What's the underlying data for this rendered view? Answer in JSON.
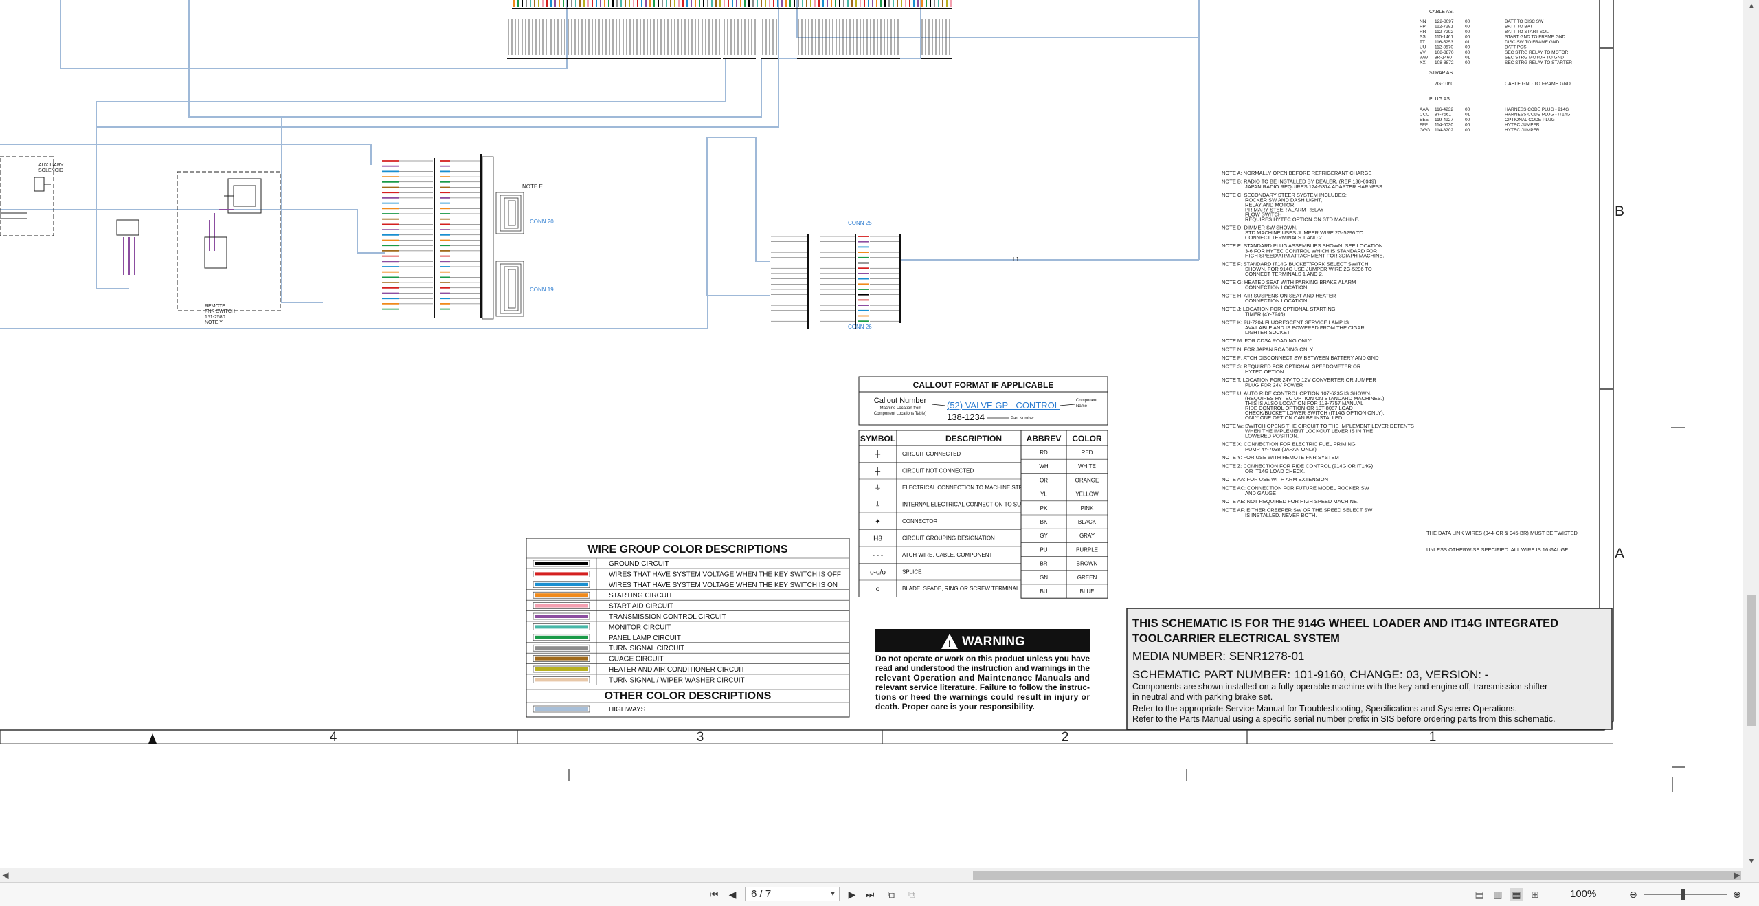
{
  "wire_colors": [
    {
      "label": "GROUND CIRCUIT",
      "color": "#000000"
    },
    {
      "label": "WIRES THAT HAVE SYSTEM VOLTAGE WHEN THE KEY SWITCH IS OFF",
      "color": "#d42020"
    },
    {
      "label": "WIRES THAT HAVE SYSTEM VOLTAGE WHEN THE KEY SWITCH IS ON",
      "color": "#1a8fd0"
    },
    {
      "label": "STARTING CIRCUIT",
      "color": "#f08a1c"
    },
    {
      "label": "START AID CIRCUIT",
      "color": "#f4a0b0"
    },
    {
      "label": "TRANSMISSION CONTROL CIRCUIT",
      "color": "#8c4ea0"
    },
    {
      "label": "MONITOR CIRCUIT",
      "color": "#48b8a8"
    },
    {
      "label": "PANEL LAMP CIRCUIT",
      "color": "#1a9a48"
    },
    {
      "label": "TURN SIGNAL CIRCUIT",
      "color": "#8c8c8c"
    },
    {
      "label": "GUAGE CIRCUIT",
      "color": "#a06a1c"
    },
    {
      "label": "HEATER AND AIR CONDITIONER CIRCUIT",
      "color": "#b8b020"
    },
    {
      "label": "TURN SIGNAL / WIPER WASHER CIRCUIT",
      "color": "#e8c8a8"
    }
  ],
  "wire_group_title": "WIRE GROUP COLOR DESCRIPTIONS",
  "other_color_title": "OTHER COLOR DESCRIPTIONS",
  "other_colors": [
    {
      "label": "HIGHWAYS",
      "color": "#a8bfd8"
    }
  ],
  "callout": {
    "title": "CALLOUT FORMAT IF APPLICABLE",
    "number_label": "Callout Number",
    "number_sub1": "(Machine Location from",
    "number_sub2": "Component Locations Table)",
    "example": "(52) VALVE GP - CONTROL",
    "part": "138-1234",
    "component_label1": "Component",
    "component_label2": "Name",
    "part_label": "Part Number"
  },
  "symbol_table": {
    "headers": [
      "SYMBOL",
      "DESCRIPTION"
    ],
    "rows": [
      {
        "sym": "┼",
        "desc": "CIRCUIT CONNECTED"
      },
      {
        "sym": "┼",
        "desc": "CIRCUIT NOT CONNECTED"
      },
      {
        "sym": "⏚",
        "desc": "ELECTRICAL CONNECTION TO MACHINE STRUCTURE"
      },
      {
        "sym": "⏚",
        "desc": "INTERNAL ELECTRICAL CONNECTION TO SURFACE OF COMPONENT"
      },
      {
        "sym": "✦",
        "desc": "CONNECTOR"
      },
      {
        "sym": "H8",
        "desc": "CIRCUIT GROUPING DESIGNATION"
      },
      {
        "sym": "- - -",
        "desc": "ATCH WIRE, CABLE, COMPONENT"
      },
      {
        "sym": "o-o/o",
        "desc": "SPLICE"
      },
      {
        "sym": "o",
        "desc": "BLADE, SPADE, RING OR SCREW TERMINAL"
      }
    ]
  },
  "abbrev_table": {
    "headers": [
      "ABBREV",
      "COLOR"
    ],
    "rows": [
      [
        "RD",
        "RED"
      ],
      [
        "WH",
        "WHITE"
      ],
      [
        "OR",
        "ORANGE"
      ],
      [
        "YL",
        "YELLOW"
      ],
      [
        "PK",
        "PINK"
      ],
      [
        "BK",
        "BLACK"
      ],
      [
        "GY",
        "GRAY"
      ],
      [
        "PU",
        "PURPLE"
      ],
      [
        "BR",
        "BROWN"
      ],
      [
        "GN",
        "GREEN"
      ],
      [
        "BU",
        "BLUE"
      ]
    ]
  },
  "warning": {
    "title": "WARNING",
    "text": [
      "Do not operate or work on this product unless you have",
      "read and understood the instruction and warnings in the",
      "relevant Operation and Maintenance Manuals and",
      "relevant service literature. Failure to follow the instruc-",
      "tions or heed the warnings could result in injury or",
      "death. Proper care is your responsibility."
    ]
  },
  "title_block": {
    "line1": "THIS SCHEMATIC IS FOR THE 914G WHEEL LOADER AND IT14G INTEGRATED",
    "line2": "TOOLCARRIER ELECTRICAL SYSTEM",
    "media": "MEDIA NUMBER: SENR1278-01",
    "part": "SCHEMATIC PART NUMBER: 101-9160, CHANGE: 03, VERSION: -",
    "notes": [
      "Components are shown installed on a fully operable machine with the key and engine off, transmission shifter",
      "in neutral and with parking brake set.",
      "Refer to the appropriate Service Manual for Troubleshooting, Specifications and Systems Operations.",
      "Refer to the Parts Manual using a specific serial number prefix in SIS before ordering parts from this schematic."
    ]
  },
  "zone_columns": [
    "4",
    "3",
    "2",
    "1"
  ],
  "zone_rows": [
    "B",
    "A"
  ],
  "connectors": {
    "conn_a": "CONN 20",
    "conn_b": "CONN 19",
    "conn_c": "CONN 25",
    "conn_d": "CONN 26",
    "note_e": "NOTE E",
    "remote": "REMOTE",
    "remote2": "FNR SWITCH",
    "remote3": "151-2580",
    "remote4": "NOTE Y",
    "aux": "AUXILIARY",
    "solenoid": "SOLENOID",
    "l1": "L1"
  },
  "notes": [
    "NOTE A: NORMALLY OPEN BEFORE REFRIGERANT CHARGE",
    "NOTE B: RADIO TO BE INSTALLED BY DEALER. (REF 138-6949)",
    "JAPAN RADIO REQUIRES 124-5314 ADAPTER HARNESS.",
    "NOTE C: SECONDARY STEER SYSTEM INCLUDES:",
    "ROCKER SW AND DASH LIGHT,",
    "RELAY AND MOTOR,",
    "PRIMARY STEER ALARM RELAY",
    "FLOW SWITCH",
    "REQUIRES HYTEC OPTION ON STD MACHINE.",
    "NOTE D: DIMMER SW SHOWN.",
    "STD MACHINE USES JUMPER WIRE 2G-5296 TO",
    "CONNECT TERMINALS 1 AND 2.",
    "NOTE E: STANDARD PLUG ASSEMBLIES SHOWN, SEE LOCATION",
    "3-6 FOR HYTEC CONTROL WHICH IS STANDARD FOR",
    "HIGH SPEED/ARM ATTACHMENT FOR 3DIAPH MACHINE.",
    "NOTE F: STANDARD IT14G BUCKET/FORK SELECT SWITCH",
    "SHOWN. FOR 914G USE JUMPER WIRE 2G-5296 TO",
    "CONNECT TERMINALS 1 AND 2.",
    "NOTE G: HEATED SEAT WITH PARKING BRAKE ALARM",
    "CONNECTION LOCATION.",
    "NOTE H: AIR SUSPENSION SEAT AND HEATER",
    "CONNECTION LOCATION.",
    "NOTE J: LOCATION FOR OPTIONAL STARTING",
    "TIMER (4Y-7946)",
    "NOTE K: 9U-7204 FLUORESCENT SERVICE LAMP IS",
    "AVAILABLE AND IS POWERED FROM THE CIGAR",
    "LIGHTER SOCKET",
    "NOTE M: FOR CDSA ROADING ONLY",
    "NOTE N: FOR JAPAN ROADING ONLY",
    "NOTE P: ATCH DISCONNECT SW BETWEEN BATTERY AND GND",
    "NOTE S: REQUIRED FOR OPTIONAL SPEEDOMETER OR",
    "HYTEC OPTION.",
    "NOTE T: LOCATION FOR 24V TO 12V CONVERTER OR JUMPER",
    "PLUG FOR 24V POWER",
    "NOTE U: AUTO RIDE CONTROL OPTION 107-6235 IS SHOWN.",
    "(REQUIRES HYTEC OPTION ON STANDARD MACHINES.)",
    "THIS IS ALSO LOCATION FOR 118-7757 MANUAL",
    "RIDE CONTROL OPTION OR 10T-8087 LOAD",
    "CHECK/BUCKET LOWER SWITCH (IT14G OPTION ONLY).",
    "ONLY ONE OPTION CAN BE INSTALLED.",
    "NOTE W: SWITCH OPENS THE CIRCUIT TO THE IMPLEMENT LEVER DETENTS",
    "WHEN THE IMPLEMENT LOCKOUT LEVER IS IN THE",
    "LOWERED POSITION.",
    "NOTE X: CONNECTION FOR ELECTRIC FUEL PRIMING",
    "PUMP 4Y-7038 (JAPAN ONLY)",
    "NOTE Y: FOR USE WITH REMOTE FNR SYSTEM",
    "NOTE Z: CONNECTION FOR RIDE CONTROL (914G OR IT14G)",
    "OR IT14G LOAD CHECK.",
    "NOTE AA: FOR USE WITH ARM EXTENSION",
    "NOTE AC: CONNECTION FOR FUTURE MODEL ROCKER SW",
    "AND GAUGE",
    "NOTE AE: NOT REQUIRED FOR HIGH SPEED MACHINE.",
    "NOTE AF: EITHER CREEPER SW OR THE SPEED SELECT SW",
    "IS INSTALLED. NEVER BOTH."
  ],
  "side_notes": [
    "THE DATA LINK WIRES (944-OR & 945-BR) MUST BE TWISTED",
    "UNLESS OTHERWISE SPECIFIED: ALL WIRE IS 16 GAUGE"
  ],
  "cable_list": [
    [
      "NN",
      "122-8097",
      "00",
      "BATT TO DISC SW"
    ],
    [
      "PP",
      "112-7291",
      "00",
      "BATT TO BATT"
    ],
    [
      "RR",
      "112-7292",
      "00",
      "BATT TO START SOL"
    ],
    [
      "SS",
      "115-1461",
      "00",
      "START GND TO FRAME GND"
    ],
    [
      "TT",
      "116-5253",
      "01",
      "DISC SW TO FRAME GND"
    ],
    [
      "UU",
      "112-8570",
      "00",
      "BATT POS"
    ],
    [
      "VV",
      "108-8870",
      "00",
      "SEC STRG RELAY TO MOTOR"
    ],
    [
      "WW",
      "8R-1460",
      "01",
      "SEC STRG MOTOR TO GND"
    ],
    [
      "XX",
      "108-8872",
      "00",
      "SEC STRG RELAY TO STARTER"
    ]
  ],
  "plug_list": [
    [
      "AAA",
      "116-4232",
      "00",
      "HARNESS CODE PLUG - 914G"
    ],
    [
      "CCC",
      "8Y-7561",
      "01",
      "HARNESS CODE PLUG - IT14G"
    ],
    [
      "EEE",
      "119-4927",
      "00",
      "OPTIONAL CODE PLUG"
    ],
    [
      "FFF",
      "114-6030",
      "00",
      "HYTEC JUMPER"
    ],
    [
      "GGG",
      "114-8202",
      "00",
      "HYTEC JUMPER"
    ]
  ],
  "cable_hdr": "CABLE AS.",
  "strap_hdr": "STRAP AS.",
  "strap_row": [
    "7G-1060",
    "CABLE GND TO FRAME GND"
  ],
  "plug_hdr": "PLUG AS.",
  "toolbar": {
    "page": "6 / 7",
    "zoom": "100%"
  }
}
